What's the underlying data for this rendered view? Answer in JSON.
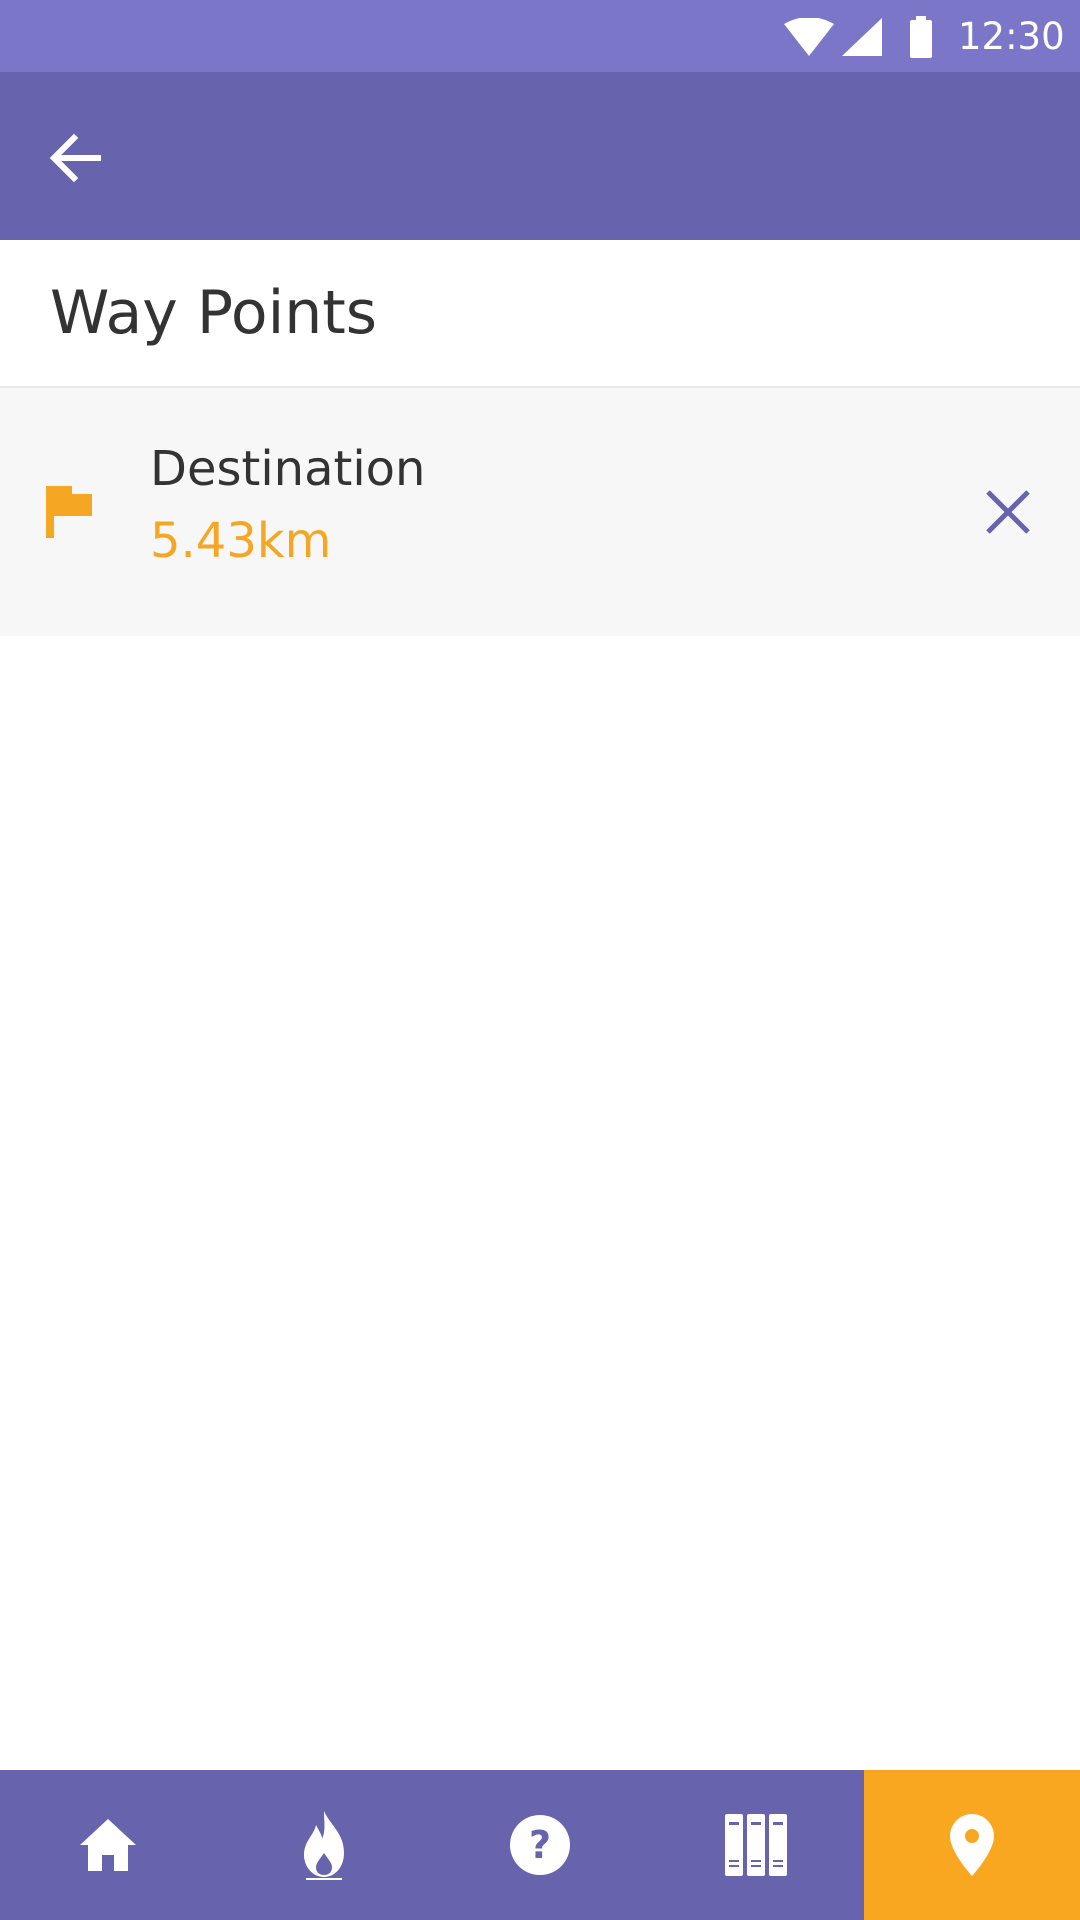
{
  "status_bar": {
    "time": "12:30",
    "icons": [
      "wifi-icon",
      "signal-icon",
      "battery-icon"
    ],
    "color": "#7c76c9"
  },
  "app_bar": {
    "back_icon": "arrow-back-icon",
    "color": "#6764ad"
  },
  "page": {
    "title": "Way Points"
  },
  "waypoints": [
    {
      "icon": "flag-icon",
      "name": "Destination",
      "distance": "5.43km",
      "remove_icon": "close-icon"
    }
  ],
  "bottom_nav": {
    "items": [
      {
        "icon": "home-icon",
        "active": false
      },
      {
        "icon": "fire-icon",
        "active": false
      },
      {
        "icon": "help-circle-icon",
        "active": false
      },
      {
        "icon": "library-icon",
        "active": false
      },
      {
        "icon": "map-pin-icon",
        "active": true
      }
    ],
    "background": "#6764ad",
    "active_color": "#f9a720"
  },
  "colors": {
    "accent": "#f5a623",
    "primary": "#6764ad",
    "text": "#333333"
  }
}
